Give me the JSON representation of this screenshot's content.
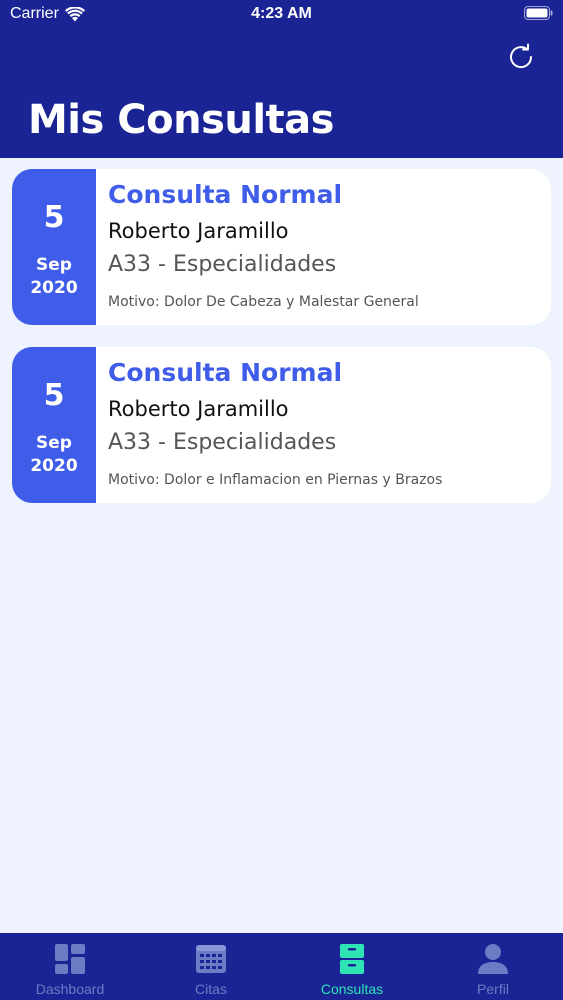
{
  "status_bar": {
    "carrier": "Carrier",
    "time": "4:23 AM"
  },
  "header": {
    "title": "Mis Consultas",
    "refresh_icon": "refresh-icon"
  },
  "consultations": [
    {
      "day": "5",
      "month": "Sep",
      "year": "2020",
      "type": "Consulta Normal",
      "doctor": "Roberto Jaramillo",
      "room": "A33 - Especialidades",
      "reason": "Motivo: Dolor De Cabeza y Malestar General"
    },
    {
      "day": "5",
      "month": "Sep",
      "year": "2020",
      "type": "Consulta Normal",
      "doctor": "Roberto Jaramillo",
      "room": "A33 - Especialidades",
      "reason": "Motivo: Dolor e Inflamacion en Piernas y Brazos"
    }
  ],
  "tab_bar": {
    "active": "Consultas",
    "tabs": [
      {
        "label": "Dashboard",
        "icon": "dashboard-icon"
      },
      {
        "label": "Citas",
        "icon": "calendar-icon"
      },
      {
        "label": "Consultas",
        "icon": "archive-icon"
      },
      {
        "label": "Perfil",
        "icon": "user-icon"
      }
    ]
  },
  "colors": {
    "header_bg": "#1b2494",
    "accent": "#3f5de8",
    "active_tab": "#2fe3b2",
    "inactive_tab": "#6b7cc4",
    "page_bg": "#eef3fd"
  }
}
